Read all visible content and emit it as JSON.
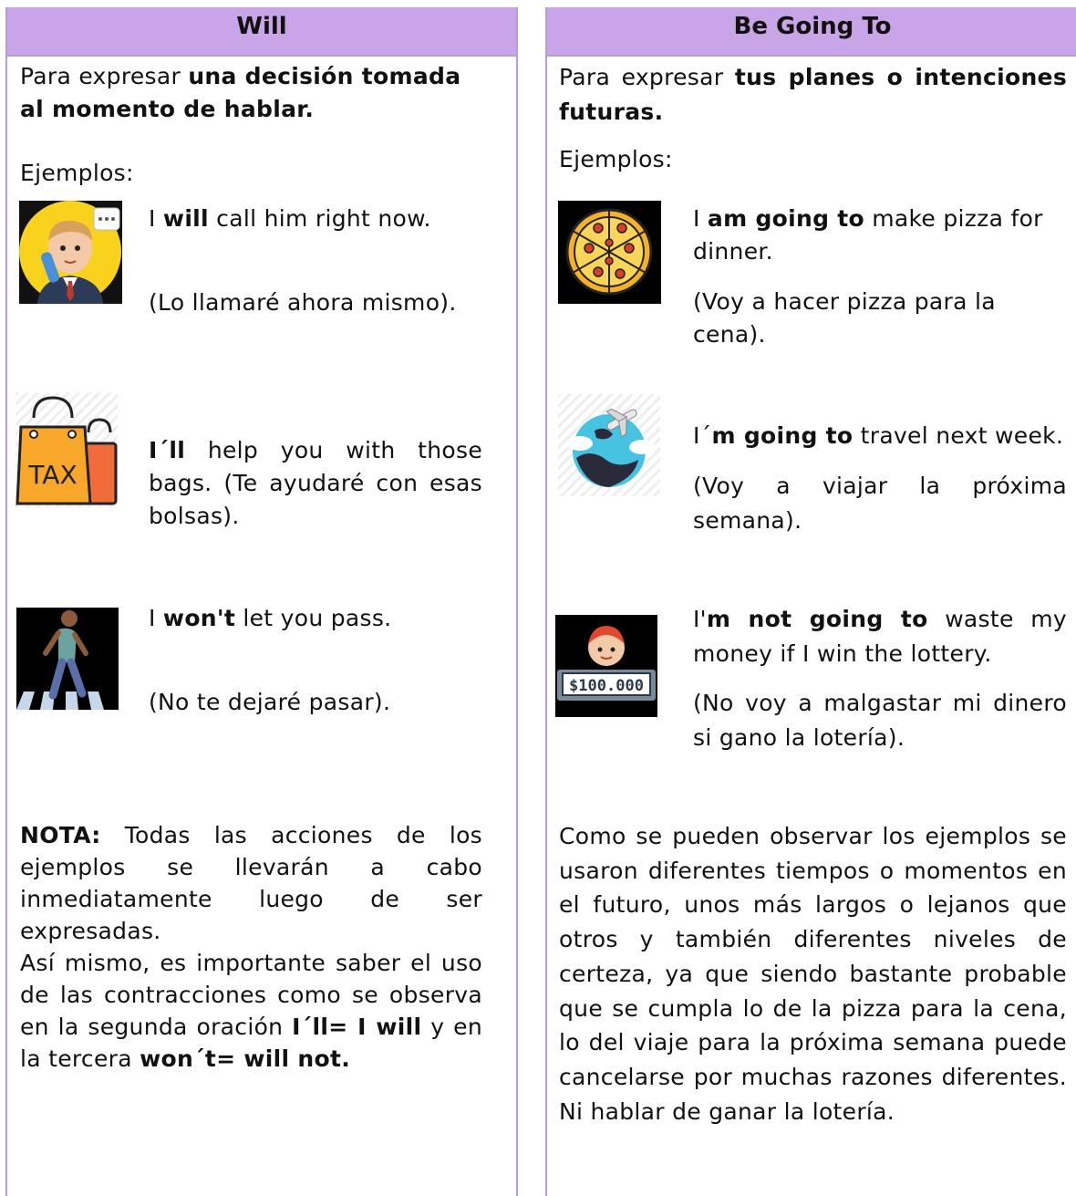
{
  "will": {
    "header": "Will",
    "intro_prefix": "Para expresar ",
    "intro_bold": "una decisión tomada al momento de hablar.",
    "examples_label": "Ejemplos:",
    "ex1": {
      "pre": "I ",
      "bold": "will",
      "post": " call him right now.",
      "translation": "(Lo llamaré ahora mismo)."
    },
    "ex2": {
      "bold": "I´ll",
      "post": " help you with those bags.",
      "translation": "(Te ayudaré con esas bolsas).",
      "icon_text": "TAX"
    },
    "ex3": {
      "pre": "I ",
      "bold": "won't",
      "post": " let you pass.",
      "translation": "(No te dejaré pasar)."
    },
    "note_label": "NOTA:",
    "note_text": " Todas las acciones de los ejemplos se llevarán a cabo inmediatamente luego de ser expresadas.",
    "note2_prefix": "Así mismo, es importante saber el uso de las contracciones como se observa en la segunda oración ",
    "note2_bold1": "I´ll= I will",
    "note2_mid": " y en la tercera ",
    "note2_bold2": "won´t= will not."
  },
  "going": {
    "header": "Be Going To",
    "intro_prefix": "Para expresar ",
    "intro_bold": "tus planes o intenciones futuras.",
    "examples_label": "Ejemplos:",
    "ex1": {
      "pre": "I ",
      "bold": "am going to",
      "post": " make pizza for dinner.",
      "translation": "(Voy a hacer pizza para la cena)."
    },
    "ex2": {
      "pre": "I´",
      "bold": "m going to",
      "post": " travel next week.",
      "translation": "(Voy a viajar la próxima semana)."
    },
    "ex3": {
      "pre": "I'",
      "bold": "m not going to",
      "post": " waste my money if I win the lottery.",
      "translation": "(No voy a malgastar mi dinero si gano la lotería).",
      "icon_text": "$100.000"
    },
    "conclusion": "Como se pueden observar los ejemplos se usaron diferentes tiempos o momentos en el futuro, unos más largos o lejanos que otros y también diferentes niveles de certeza, ya que siendo bastante probable que se cumpla lo de la pizza para la cena, lo del viaje para la próxima semana puede cancelarse por muchas razones diferentes. Ni hablar de ganar la lotería."
  }
}
